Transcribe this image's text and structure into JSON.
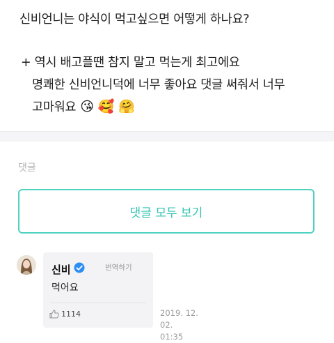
{
  "post": {
    "lines": [
      "신비언니는 야식이 먹고싶으면 어떻게 하나요?",
      "+ 역시 배고플땐 참지 말고 먹는게 최고에요",
      "명쾌한 신비언니덕에 너무 좋아요 댓글 써줘서 너무",
      "고마워요"
    ],
    "emojis": [
      "😘",
      "🥰",
      "🤗"
    ]
  },
  "comments": {
    "heading": "댓글",
    "view_all_label": "댓글 모두 보기",
    "items": [
      {
        "author": "신비",
        "verified": true,
        "translate_label": "번역하기",
        "text": "먹어요",
        "likes": "1114",
        "date": "2019. 12. 02.",
        "time": "01:35"
      }
    ]
  },
  "colors": {
    "accent": "#33c4b2",
    "accent_border": "#4fd2c2",
    "verified_badge": "#2f8ef4"
  }
}
